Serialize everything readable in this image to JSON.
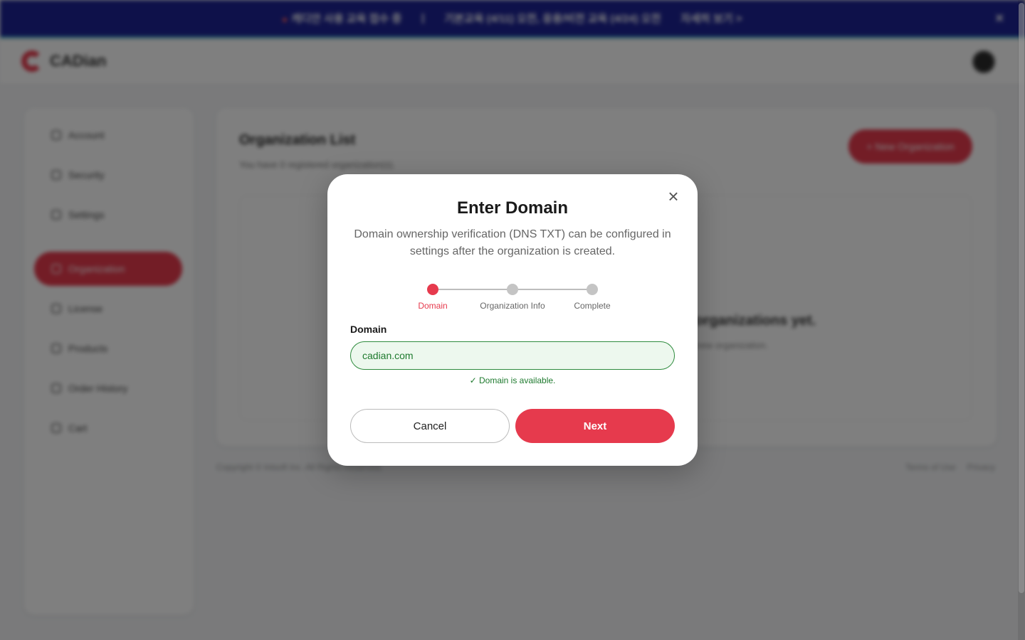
{
  "banner": {
    "items": [
      "캐디안 사용 교육 접수 중",
      "|",
      "기본교육 (4/11) 오전, 응용/비전 교육 (4/24) 오전",
      "자세히 보기 >"
    ],
    "close_icon": "close-icon"
  },
  "header": {
    "brand": "CADian"
  },
  "sidebar": {
    "items": [
      {
        "label": "Account",
        "icon": "user-icon"
      },
      {
        "label": "Security",
        "icon": "shield-icon"
      },
      {
        "label": "Settings",
        "icon": "gear-icon"
      },
      {
        "label": "Organization",
        "icon": "users-icon",
        "active": true
      },
      {
        "label": "License",
        "icon": "license-icon"
      },
      {
        "label": "Products",
        "icon": "box-icon"
      },
      {
        "label": "Order History",
        "icon": "receipt-icon"
      },
      {
        "label": "Cart",
        "icon": "cart-icon"
      }
    ]
  },
  "main": {
    "title": "Organization List",
    "subtitle": "You have 0 registered organization(s).",
    "new_button": "+ New Organization",
    "empty_title": "No organizations yet.",
    "empty_sub": "Create a new organization."
  },
  "footer": {
    "copyright": "Copyright © Intsoft Inc. All Rights Reserved.",
    "links": [
      "Terms of Use",
      "Privacy"
    ]
  },
  "modal": {
    "title": "Enter Domain",
    "description": "Domain ownership verification (DNS TXT) can be configured in settings after the organization is created.",
    "steps": [
      {
        "label": "Domain",
        "active": true
      },
      {
        "label": "Organization Info",
        "active": false
      },
      {
        "label": "Complete",
        "active": false
      }
    ],
    "field_label": "Domain",
    "domain_value": "cadian.com",
    "valid_message": "✓ Domain is available.",
    "cancel_label": "Cancel",
    "next_label": "Next",
    "close_symbol": "×"
  },
  "colors": {
    "accent": "#e63a4d",
    "banner": "#1d2394",
    "success": "#1e7a2e",
    "success_bg": "#edf8ee"
  }
}
